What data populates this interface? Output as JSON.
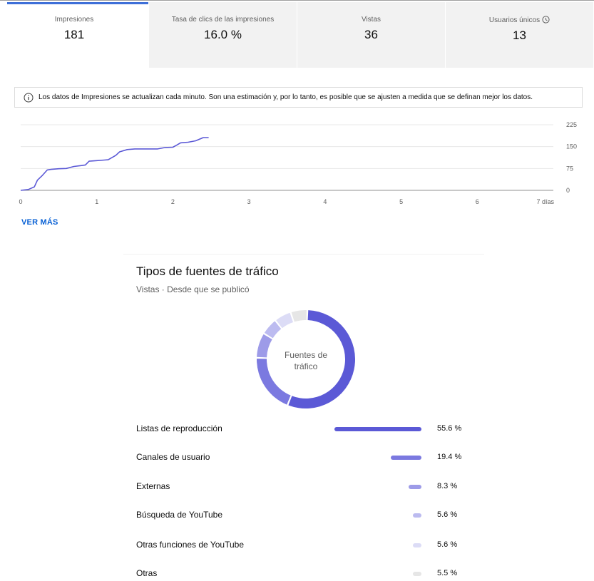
{
  "metrics": [
    {
      "label": "Impresiones",
      "value": "181",
      "active": true
    },
    {
      "label": "Tasa de clics de las impresiones",
      "value": "16.0 %",
      "active": false
    },
    {
      "label": "Vistas",
      "value": "36",
      "active": false
    },
    {
      "label": "Usuarios únicos",
      "value": "13",
      "active": false,
      "icon": "clock-icon"
    }
  ],
  "notice": {
    "icon": "info-icon",
    "text": "Los datos de Impresiones se actualizan cada minuto. Son una estimación y, por lo tanto, es posible que se ajusten a medida que se definan mejor los datos."
  },
  "chart_data": {
    "type": "line",
    "title": "",
    "xlabel": "",
    "ylabel": "",
    "x_ticks": [
      "0",
      "1",
      "2",
      "3",
      "4",
      "5",
      "6",
      "7 días"
    ],
    "y_ticks": [
      "0",
      "75",
      "150",
      "225"
    ],
    "xlim": [
      0,
      7
    ],
    "ylim": [
      0,
      225
    ],
    "grid": true,
    "series": [
      {
        "color": "#5b59d6",
        "x": [
          0,
          0.1,
          0.18,
          0.22,
          0.28,
          0.35,
          0.4,
          0.5,
          0.6,
          0.7,
          0.8,
          0.85,
          0.9,
          1.0,
          1.1,
          1.15,
          1.25,
          1.3,
          1.4,
          1.5,
          1.6,
          1.7,
          1.8,
          1.9,
          2.0,
          2.05,
          2.1,
          2.2,
          2.3,
          2.4,
          2.47
        ],
        "y": [
          0,
          3,
          12,
          35,
          50,
          70,
          72,
          74,
          75,
          82,
          85,
          87,
          100,
          102,
          104,
          105,
          120,
          132,
          140,
          142,
          142,
          142,
          142,
          147,
          148,
          155,
          163,
          165,
          170,
          181,
          181
        ]
      }
    ]
  },
  "see_more": "VER MÁS",
  "traffic": {
    "title": "Tipos de fuentes de tráfico",
    "subtitle": "Vistas · Desde que se publicó",
    "donut_label_1": "Fuentes de",
    "donut_label_2": "tráfico",
    "sources": [
      {
        "name": "Listas de reproducción",
        "pct": "55.6 %",
        "value": 55.6,
        "color": "#5b59d6"
      },
      {
        "name": "Canales de usuario",
        "pct": "19.4 %",
        "value": 19.4,
        "color": "#7b79e0"
      },
      {
        "name": "Externas",
        "pct": "8.3 %",
        "value": 8.3,
        "color": "#9d9be8"
      },
      {
        "name": "Búsqueda de YouTube",
        "pct": "5.6 %",
        "value": 5.6,
        "color": "#bcbbf0"
      },
      {
        "name": "Otras funciones de YouTube",
        "pct": "5.6 %",
        "value": 5.6,
        "color": "#dcdcf6"
      },
      {
        "name": "Otras",
        "pct": "5.5 %",
        "value": 5.5,
        "color": "#e6e6e6"
      }
    ]
  }
}
